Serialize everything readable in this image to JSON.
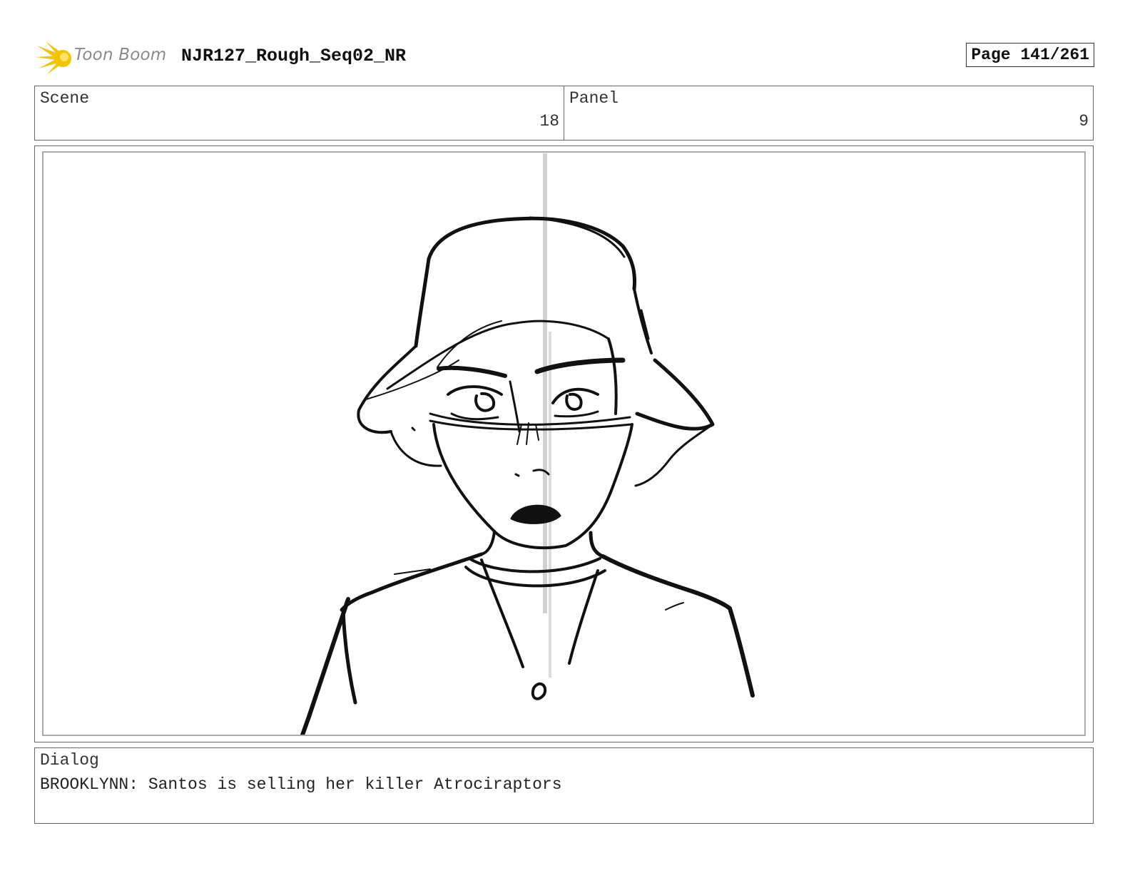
{
  "header": {
    "logo_text": "Toon Boom",
    "doc_title": "NJR127_Rough_Seq02_NR",
    "page_label": "Page 141/261"
  },
  "info": {
    "scene_label": "Scene",
    "scene_value": "18",
    "panel_label": "Panel",
    "panel_value": "9"
  },
  "dialog": {
    "label": "Dialog",
    "text": "BROOKLYNN: Santos is selling her killer Atrociraptors"
  },
  "colors": {
    "logo_star": "#f5c400",
    "sketch_line": "#111111",
    "guide_line": "#d0d0d0"
  }
}
